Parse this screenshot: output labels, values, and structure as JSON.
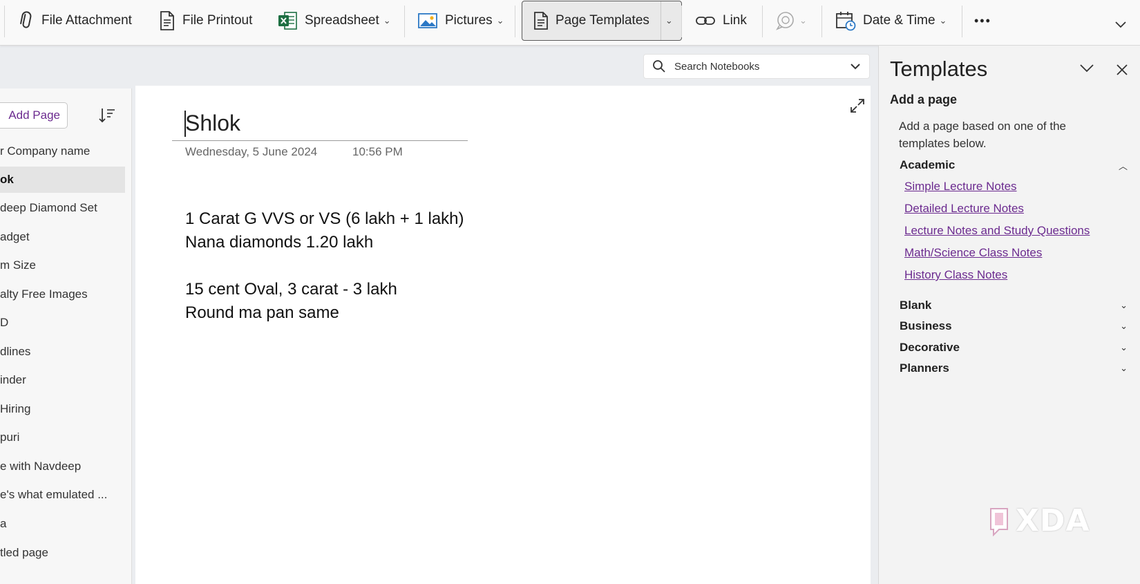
{
  "ribbon": {
    "file_attachment": "File Attachment",
    "file_printout": "File Printout",
    "spreadsheet": "Spreadsheet",
    "pictures": "Pictures",
    "page_templates": "Page Templates",
    "link": "Link",
    "date_time": "Date & Time",
    "more": "•••"
  },
  "search": {
    "placeholder": "Search Notebooks"
  },
  "pagelist": {
    "add_page": "Add Page",
    "items": [
      "r Company name",
      "ok",
      "deep Diamond Set",
      "adget",
      "m Size",
      "alty Free Images",
      "D",
      "dlines",
      "inder",
      "Hiring",
      "puri",
      "e with Navdeep",
      "e's what emulated ...",
      "a",
      "tled page"
    ],
    "active_index": 1
  },
  "page": {
    "title": "Shlok",
    "date": "Wednesday, 5 June 2024",
    "time": "10:56 PM",
    "lines": [
      "1 Carat G VVS or VS (6 lakh + 1 lakh)",
      "Nana diamonds 1.20 lakh",
      "15 cent Oval, 3 carat - 3 lakh",
      "Round ma pan same"
    ]
  },
  "templates": {
    "title": "Templates",
    "subtitle": "Add a page",
    "description": "Add a page based on one of the templates below.",
    "categories": [
      {
        "name": "Academic",
        "expanded": true,
        "items": [
          "Simple Lecture Notes",
          "Detailed Lecture Notes",
          "Lecture Notes and Study Questions",
          "Math/Science Class Notes",
          "History Class Notes"
        ]
      },
      {
        "name": "Blank",
        "expanded": false
      },
      {
        "name": "Business",
        "expanded": false
      },
      {
        "name": "Decorative",
        "expanded": false
      },
      {
        "name": "Planners",
        "expanded": false
      }
    ]
  },
  "colors": {
    "link": "#6b2a8f",
    "excel_green": "#1d6f42"
  },
  "watermark": "XDA"
}
